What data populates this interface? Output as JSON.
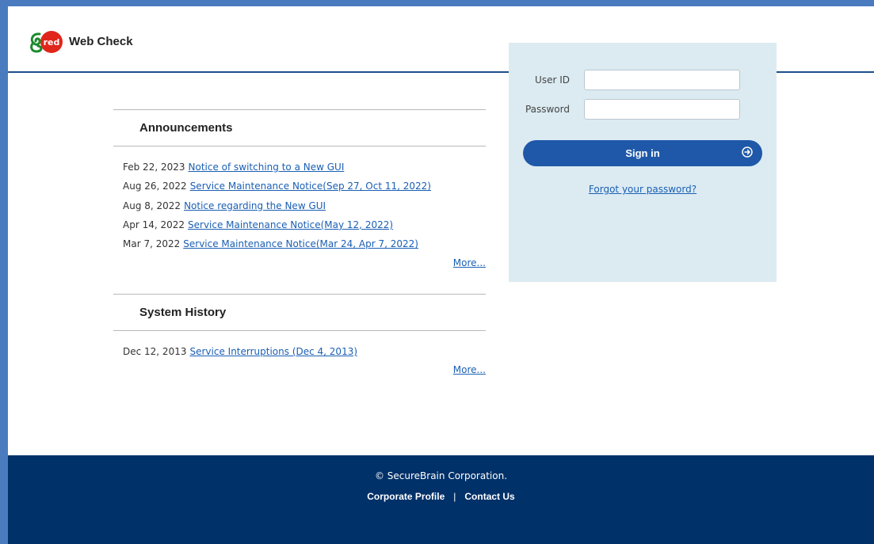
{
  "header": {
    "title": "Web Check",
    "logo_text": "red"
  },
  "announcements": {
    "title": "Announcements",
    "items": [
      {
        "date": "Feb 22, 2023",
        "link": "Notice of switching to a New GUI"
      },
      {
        "date": "Aug 26, 2022",
        "link": "Service Maintenance Notice(Sep 27, Oct 11, 2022)"
      },
      {
        "date": "Aug 8, 2022",
        "link": "Notice regarding the New GUI"
      },
      {
        "date": "Apr 14, 2022",
        "link": "Service Maintenance Notice(May 12, 2022)"
      },
      {
        "date": "Mar 7, 2022",
        "link": "Service Maintenance Notice(Mar 24, Apr 7, 2022)"
      }
    ],
    "more": "More..."
  },
  "history": {
    "title": "System History",
    "items": [
      {
        "date": "Dec 12, 2013",
        "link": "Service Interruptions (Dec 4, 2013)"
      }
    ],
    "more": "More..."
  },
  "login": {
    "userid_label": "User ID",
    "userid_value": "",
    "password_label": "Password",
    "password_value": "",
    "signin_label": "Sign in",
    "forgot_label": "Forgot your password?"
  },
  "footer": {
    "copyright": "© SecureBrain Corporation.",
    "corporate_profile": "Corporate Profile",
    "separator": "|",
    "contact": "Contact Us"
  },
  "colors": {
    "brand_blue": "#003169",
    "button_blue": "#1f58a8",
    "link": "#1a5fb4"
  }
}
